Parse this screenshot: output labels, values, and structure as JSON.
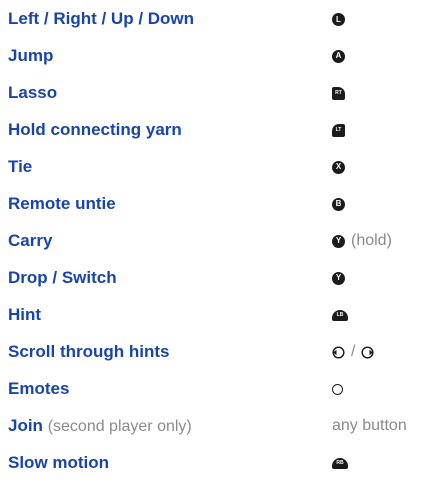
{
  "controls": [
    {
      "action": "Left / Right / Up / Down",
      "icon_label": "L"
    },
    {
      "action": "Jump",
      "icon_label": "A"
    },
    {
      "action": "Lasso",
      "icon_label": "RT"
    },
    {
      "action": "Hold connecting yarn",
      "icon_label": "LT"
    },
    {
      "action": "Tie",
      "icon_label": "X"
    },
    {
      "action": "Remote untie",
      "icon_label": "B"
    },
    {
      "action": "Carry",
      "icon_label": "Y",
      "suffix": "(hold)"
    },
    {
      "action": "Drop / Switch",
      "icon_label": "Y"
    },
    {
      "action": "Hint",
      "icon_label": "LB"
    },
    {
      "action": "Scroll through hints",
      "separator": "/"
    },
    {
      "action": "Emotes"
    },
    {
      "action": "Join",
      "note": "(second player only)",
      "text": "any button"
    },
    {
      "action": "Slow motion",
      "icon_label": "RB"
    }
  ]
}
